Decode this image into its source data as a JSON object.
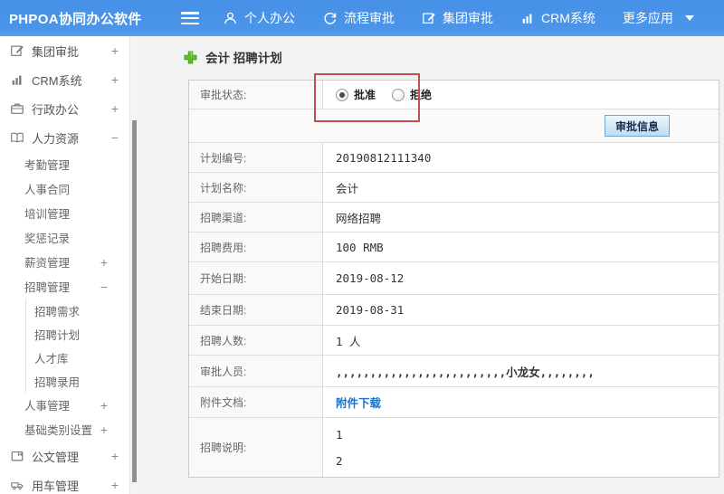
{
  "topbar": {
    "logo": "PHPOA协同办公软件",
    "nav": [
      {
        "label": "个人办公",
        "icon": "user-icon"
      },
      {
        "label": "流程审批",
        "icon": "cycle-icon"
      },
      {
        "label": "集团审批",
        "icon": "edit-icon"
      },
      {
        "label": "CRM系统",
        "icon": "chart-icon"
      },
      {
        "label": "更多应用",
        "icon": "caret-down-icon"
      }
    ]
  },
  "sidebar": {
    "items": [
      {
        "label": "集团审批",
        "level": 1,
        "icon": "edit-icon",
        "expander": "+"
      },
      {
        "label": "CRM系统",
        "level": 1,
        "icon": "chart-icon",
        "expander": "+"
      },
      {
        "label": "行政办公",
        "level": 1,
        "icon": "briefcase-icon",
        "expander": "+"
      },
      {
        "label": "人力资源",
        "level": 1,
        "icon": "book-icon",
        "expander": "−"
      },
      {
        "label": "考勤管理",
        "level": 2
      },
      {
        "label": "人事合同",
        "level": 2
      },
      {
        "label": "培训管理",
        "level": 2
      },
      {
        "label": "奖惩记录",
        "level": 2
      },
      {
        "label": "薪资管理",
        "level": 2,
        "expander": "+"
      },
      {
        "label": "招聘管理",
        "level": 2,
        "expander": "−"
      },
      {
        "label": "招聘需求",
        "level": 3
      },
      {
        "label": "招聘计划",
        "level": 3
      },
      {
        "label": "人才库",
        "level": 3
      },
      {
        "label": "招聘录用",
        "level": 3
      },
      {
        "label": "人事管理",
        "level": 2,
        "expander": "+"
      },
      {
        "label": "基础类别设置",
        "level": 2,
        "expander": "+"
      },
      {
        "label": "公文管理",
        "level": 1,
        "icon": "document-icon",
        "expander": "+"
      },
      {
        "label": "用车管理",
        "level": 1,
        "icon": "truck-icon",
        "expander": "+"
      }
    ]
  },
  "main": {
    "title": "会计 招聘计划",
    "approval": {
      "label": "审批状态:",
      "options": [
        {
          "label": "批准",
          "checked": true
        },
        {
          "label": "拒绝",
          "checked": false
        }
      ],
      "button_label": "审批信息"
    },
    "fields": [
      {
        "label": "计划编号:",
        "value": "20190812111340"
      },
      {
        "label": "计划名称:",
        "value": "会计"
      },
      {
        "label": "招聘渠道:",
        "value": "网络招聘"
      },
      {
        "label": "招聘费用:",
        "value": "100 RMB"
      },
      {
        "label": "开始日期:",
        "value": "2019-08-12"
      },
      {
        "label": "结束日期:",
        "value": "2019-08-31"
      },
      {
        "label": "招聘人数:",
        "value": "1 人"
      },
      {
        "label": "审批人员:",
        "value": ",,,,,,,,,,,,,,,,,,,,,,,,,小龙女,,,,,,,,"
      },
      {
        "label": "附件文档:",
        "value": "附件下载"
      },
      {
        "label": "招聘说明:",
        "lines": [
          "1",
          "2"
        ]
      }
    ]
  },
  "colors": {
    "topbar_blue": "#4a93e8",
    "red_annotation": "#c0504d",
    "link_blue": "#1d73c9",
    "button_border_blue": "#6ea7d8",
    "plus_green": "#62bb2a"
  }
}
